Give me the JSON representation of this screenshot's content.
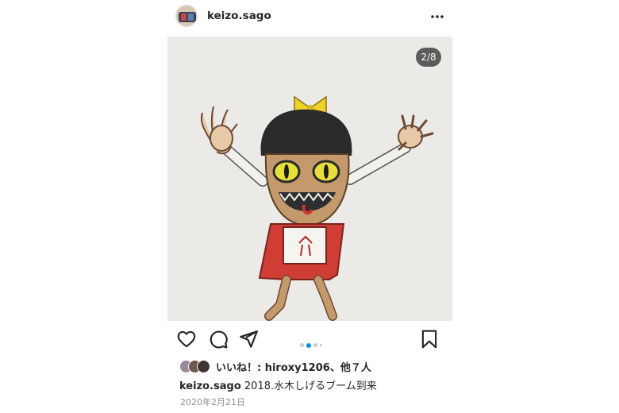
{
  "header": {
    "username": "keizo.sago",
    "avatar_icon": "profile-avatar",
    "more_icon": "more-horizontal-icon"
  },
  "post": {
    "image_counter": "2/8",
    "image_icon": "drawing-girl-monster",
    "carousel": {
      "total_dots_visible": 5,
      "active_index": 1
    }
  },
  "actions": {
    "like_icon": "heart-icon",
    "comment_icon": "comment-icon",
    "share_icon": "send-icon",
    "save_icon": "bookmark-icon"
  },
  "likes": {
    "text": "いいね！: hiroxy1206、他７人"
  },
  "caption": {
    "username": "keizo.sago",
    "text": " 2018.水木しげるブーム到来"
  },
  "date": "2020年2月21日",
  "colors": {
    "accent": "#0095f6",
    "text": "#262626",
    "muted": "#8e8e8e"
  }
}
